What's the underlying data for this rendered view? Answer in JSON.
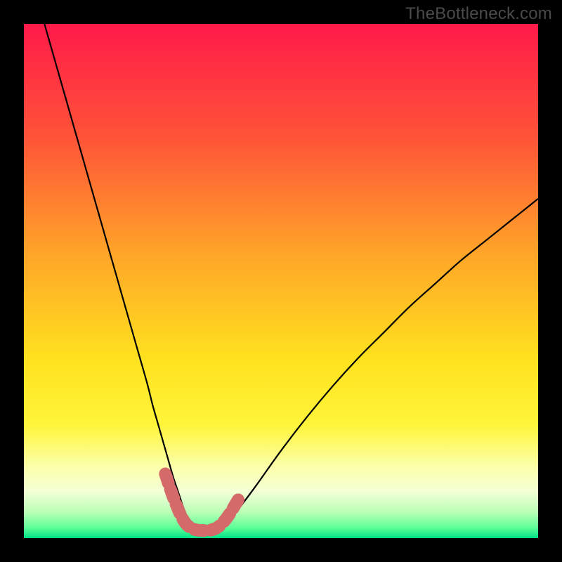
{
  "watermark": "TheBottleneck.com",
  "chart_data": {
    "type": "line",
    "title": "",
    "xlabel": "",
    "ylabel": "",
    "xlim": [
      0,
      100
    ],
    "ylim": [
      0,
      100
    ],
    "grid": false,
    "legend": false,
    "background": {
      "type": "vertical-gradient",
      "stops": [
        {
          "pct": 0,
          "color": "#ff1a49"
        },
        {
          "pct": 22,
          "color": "#ff5338"
        },
        {
          "pct": 45,
          "color": "#ffa628"
        },
        {
          "pct": 65,
          "color": "#ffe11e"
        },
        {
          "pct": 78,
          "color": "#fff53a"
        },
        {
          "pct": 86,
          "color": "#fcffa9"
        },
        {
          "pct": 91,
          "color": "#f3ffd6"
        },
        {
          "pct": 95,
          "color": "#b9ffb6"
        },
        {
          "pct": 98,
          "color": "#5cff97"
        },
        {
          "pct": 100,
          "color": "#00e087"
        }
      ]
    },
    "series": [
      {
        "name": "bottleneck-curve",
        "stroke": "#000000",
        "stroke_width": 2.2,
        "x": [
          4,
          6,
          8,
          10,
          12,
          14,
          16,
          18,
          20,
          22,
          24,
          25,
          26,
          27,
          28,
          29,
          30,
          31,
          32,
          33,
          34,
          35,
          36,
          37,
          38,
          40,
          42,
          45,
          50,
          55,
          60,
          65,
          70,
          75,
          80,
          85,
          90,
          95,
          100
        ],
        "y": [
          100,
          93,
          86,
          79,
          72,
          65,
          58,
          51,
          44,
          37,
          30,
          26,
          22.5,
          19,
          15.5,
          12,
          9,
          6,
          3.5,
          2,
          1.2,
          1,
          1,
          1.2,
          2,
          3.5,
          6,
          10,
          17,
          23.5,
          29.5,
          35,
          40,
          45,
          49.5,
          54,
          58,
          62,
          66
        ]
      }
    ],
    "highlight_band": {
      "name": "optimal-range",
      "color": "#d46a6a",
      "thickness": 18,
      "x": [
        27.5,
        28.5,
        29.5,
        30.5,
        31.5,
        32.5,
        33.5,
        34.5,
        35.5,
        36.5,
        37.5,
        38.5,
        39.5,
        40.5,
        42.0
      ],
      "y": [
        12.5,
        9.5,
        6.8,
        4.5,
        2.8,
        2.0,
        1.6,
        1.5,
        1.5,
        1.6,
        2.0,
        2.8,
        4.0,
        5.5,
        8.0
      ]
    }
  }
}
